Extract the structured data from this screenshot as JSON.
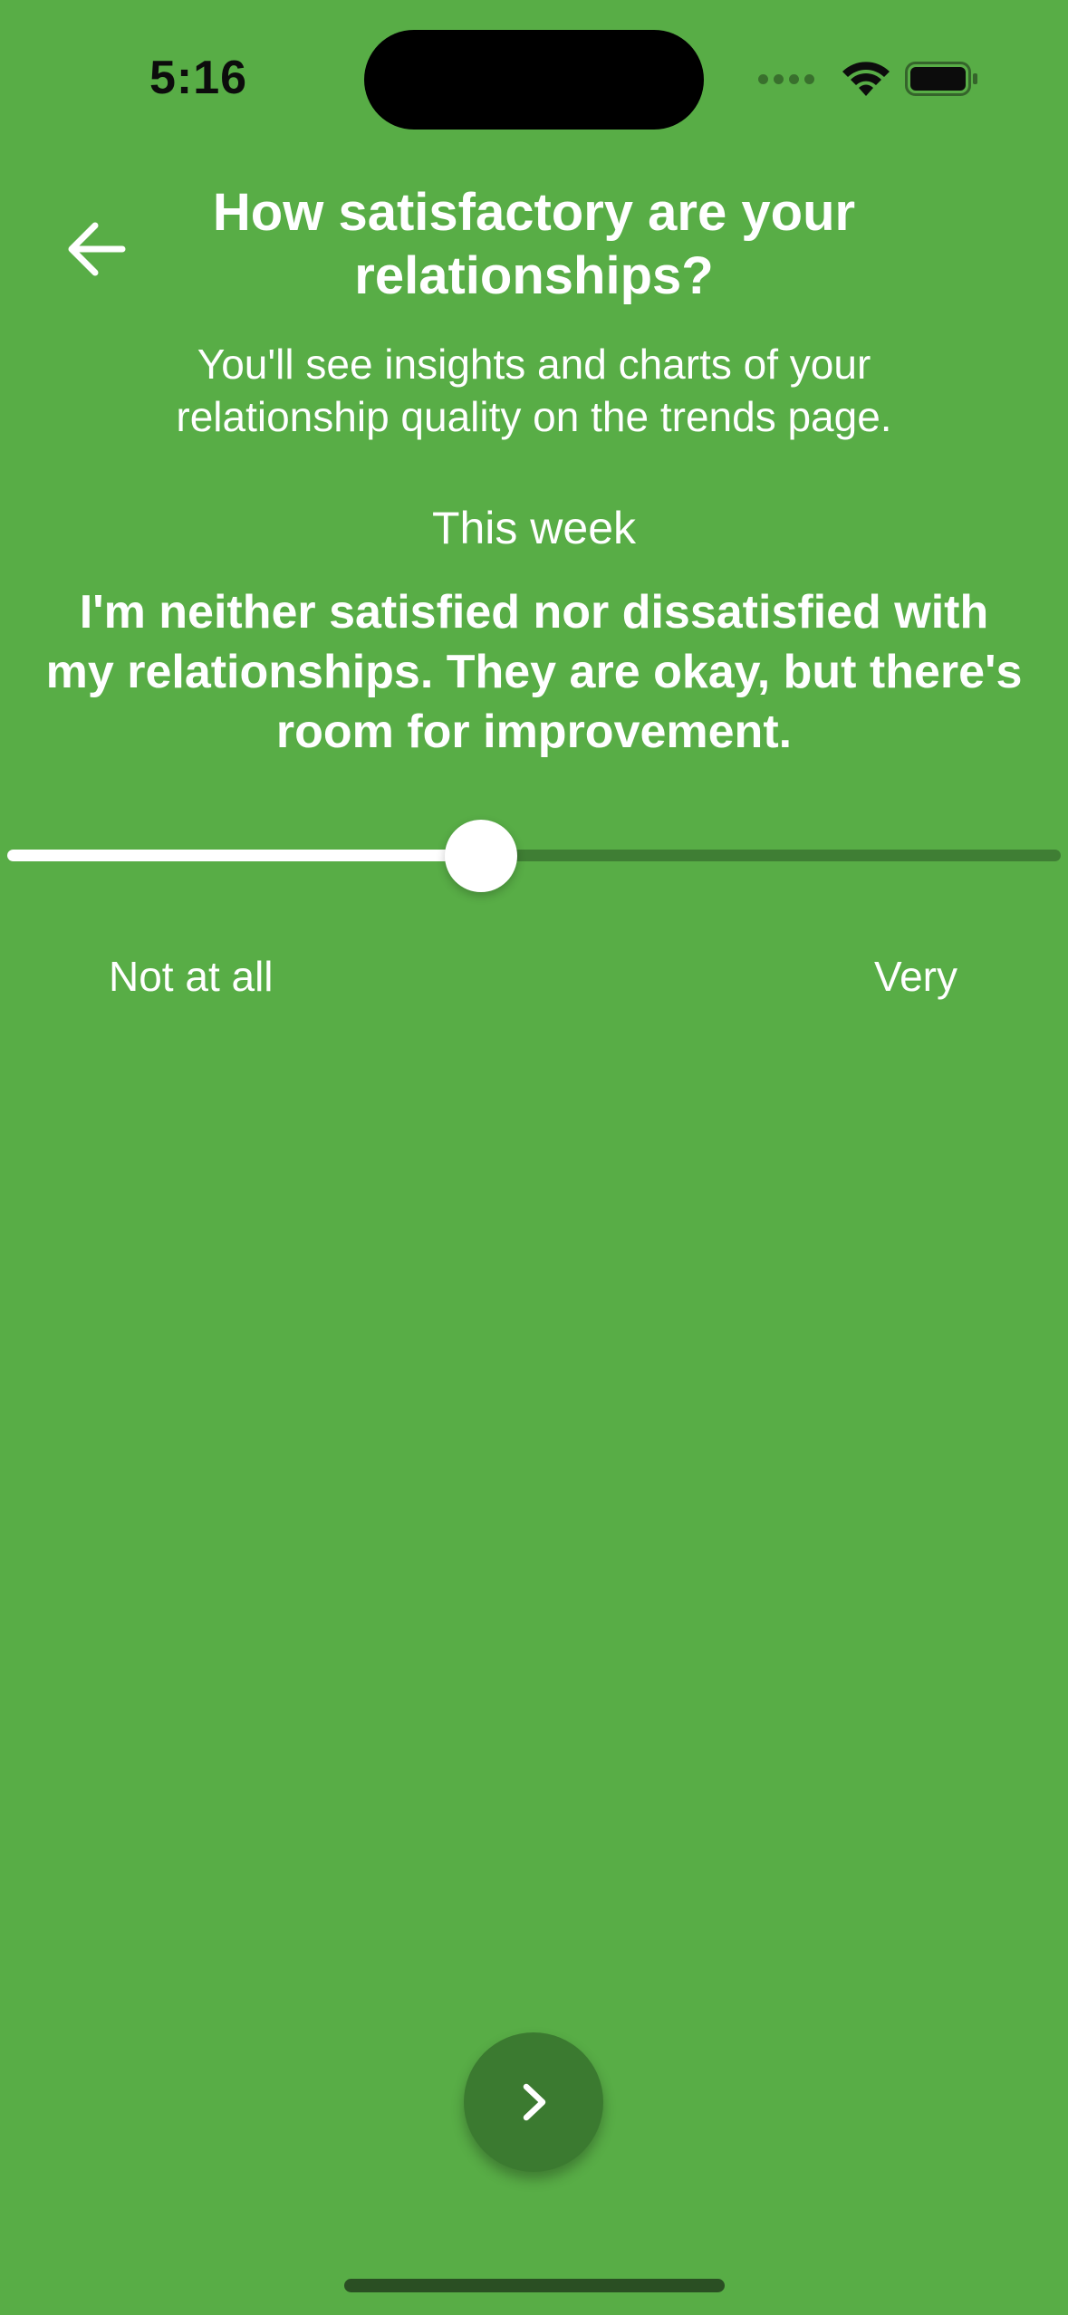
{
  "status_bar": {
    "time": "5:16",
    "icons": [
      "cellular-signal-icon",
      "wifi-icon",
      "battery-icon"
    ]
  },
  "header": {
    "back_icon": "arrow-left-icon",
    "title": "How satisfactory are your relationships?",
    "subtitle": "You'll see insights and charts of your relationship quality on the trends page."
  },
  "question": {
    "period": "This week",
    "answer": "I'm neither satisfied nor dissatisfied with my relationships. They are okay, but there's room for improvement."
  },
  "slider": {
    "value_fraction": 0.45,
    "min_label": "Not at all",
    "max_label": "Very"
  },
  "footer": {
    "next_icon": "chevron-right-icon"
  },
  "colors": {
    "background": "#58ad46",
    "track_inactive": "#3f7e34",
    "track_active": "#ffffff",
    "next_button": "#3b7a30",
    "text": "#ffffff"
  }
}
